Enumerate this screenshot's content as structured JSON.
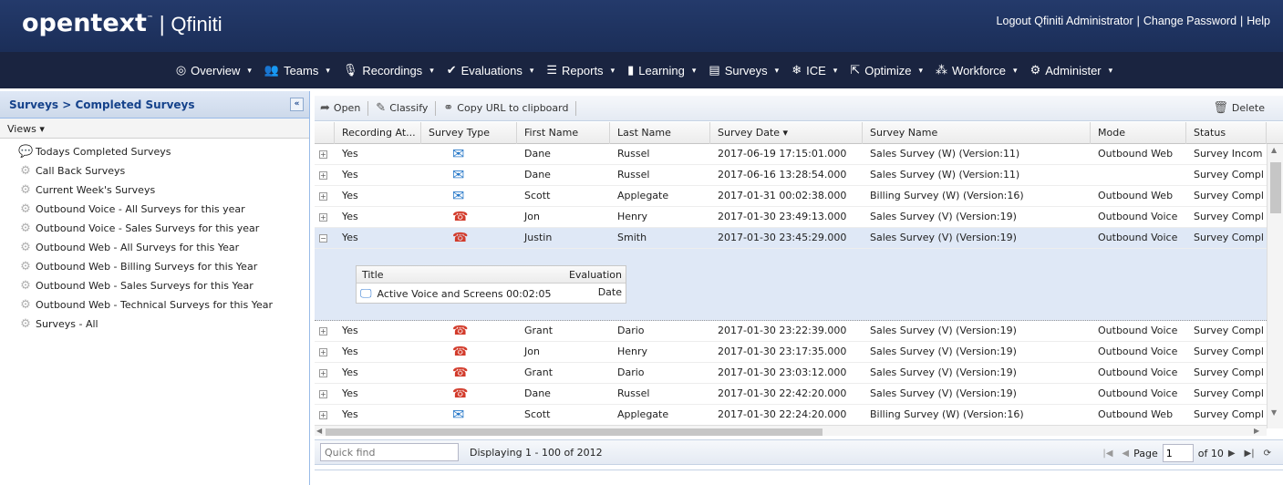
{
  "header": {
    "logo_brand": "opentext",
    "logo_tm": "™",
    "logo_sep": "|",
    "product": "Qfiniti",
    "links": [
      "Logout Qfiniti Administrator",
      "Change Password",
      "Help"
    ]
  },
  "nav": [
    {
      "label": "Overview",
      "icon": "globe-icon",
      "glyph": "◎"
    },
    {
      "label": "Teams",
      "icon": "people-icon",
      "glyph": "👥"
    },
    {
      "label": "Recordings",
      "icon": "microphone-icon",
      "glyph": "🎙"
    },
    {
      "label": "Evaluations",
      "icon": "checkmark-icon",
      "glyph": "✔"
    },
    {
      "label": "Reports",
      "icon": "report-icon",
      "glyph": "☰"
    },
    {
      "label": "Learning",
      "icon": "book-icon",
      "glyph": "▮"
    },
    {
      "label": "Surveys",
      "icon": "chat-icon",
      "glyph": "▤"
    },
    {
      "label": "ICE",
      "icon": "snowflake-icon",
      "glyph": "❄"
    },
    {
      "label": "Optimize",
      "icon": "export-icon",
      "glyph": "⇱"
    },
    {
      "label": "Workforce",
      "icon": "workforce-icon",
      "glyph": "⁂"
    },
    {
      "label": "Administer",
      "icon": "gear-icon",
      "glyph": "⚙"
    }
  ],
  "nav_caret": "▾",
  "left": {
    "title": "Surveys > Completed Surveys",
    "collapse": "«",
    "views_label": "Views ▾",
    "views": [
      "Todays Completed Surveys",
      "Call Back Surveys",
      "Current Week's Surveys",
      "Outbound Voice - All Surveys for this year",
      "Outbound Voice - Sales Surveys for this year",
      "Outbound Web - All Surveys for this Year",
      "Outbound Web - Billing Surveys for this Year",
      "Outbound Web - Sales Surveys for this Year",
      "Outbound Web - Technical Surveys for this Year",
      "Surveys - All"
    ]
  },
  "toolbar": {
    "open": "Open",
    "classify": "Classify",
    "copy_url": "Copy URL to clipboard",
    "delete": "Delete"
  },
  "grid": {
    "columns": [
      "Recording At...",
      "Survey Type",
      "First Name",
      "Last Name",
      "Survey Date ▾",
      "Survey Name",
      "Mode",
      "Status"
    ],
    "rows": [
      {
        "rec": "Yes",
        "type": "web",
        "first": "Dane",
        "last": "Russel",
        "date": "2017-06-19 17:15:01.000",
        "name": "Sales Survey (W) (Version:11)",
        "mode": "Outbound Web",
        "status": "Survey Incom"
      },
      {
        "rec": "Yes",
        "type": "web",
        "first": "Dane",
        "last": "Russel",
        "date": "2017-06-16 13:28:54.000",
        "name": "Sales Survey (W) (Version:11)",
        "mode": "",
        "status": "Survey Compl"
      },
      {
        "rec": "Yes",
        "type": "web",
        "first": "Scott",
        "last": "Applegate",
        "date": "2017-01-31 00:02:38.000",
        "name": "Billing Survey (W) (Version:16)",
        "mode": "Outbound Web",
        "status": "Survey Compl"
      },
      {
        "rec": "Yes",
        "type": "voice",
        "first": "Jon",
        "last": "Henry",
        "date": "2017-01-30 23:49:13.000",
        "name": "Sales Survey (V) (Version:19)",
        "mode": "Outbound Voice",
        "status": "Survey Compl"
      },
      {
        "rec": "Yes",
        "type": "voice",
        "first": "Justin",
        "last": "Smith",
        "date": "2017-01-30 23:45:29.000",
        "name": "Sales Survey (V) (Version:19)",
        "mode": "Outbound Voice",
        "status": "Survey Compl"
      },
      {
        "rec": "Yes",
        "type": "voice",
        "first": "Grant",
        "last": "Dario",
        "date": "2017-01-30 23:22:39.000",
        "name": "Sales Survey (V) (Version:19)",
        "mode": "Outbound Voice",
        "status": "Survey Compl"
      },
      {
        "rec": "Yes",
        "type": "voice",
        "first": "Jon",
        "last": "Henry",
        "date": "2017-01-30 23:17:35.000",
        "name": "Sales Survey (V) (Version:19)",
        "mode": "Outbound Voice",
        "status": "Survey Compl"
      },
      {
        "rec": "Yes",
        "type": "voice",
        "first": "Grant",
        "last": "Dario",
        "date": "2017-01-30 23:03:12.000",
        "name": "Sales Survey (V) (Version:19)",
        "mode": "Outbound Voice",
        "status": "Survey Compl"
      },
      {
        "rec": "Yes",
        "type": "voice",
        "first": "Dane",
        "last": "Russel",
        "date": "2017-01-30 22:42:20.000",
        "name": "Sales Survey (V) (Version:19)",
        "mode": "Outbound Voice",
        "status": "Survey Compl"
      },
      {
        "rec": "Yes",
        "type": "web",
        "first": "Scott",
        "last": "Applegate",
        "date": "2017-01-30 22:24:20.000",
        "name": "Billing Survey (W) (Version:16)",
        "mode": "Outbound Web",
        "status": "Survey Compl"
      }
    ],
    "expanded_row": 4,
    "detail": {
      "col_title": "Title",
      "col_eval": "Evaluation Date",
      "item": "Active Voice and Screens 00:02:05"
    }
  },
  "pager": {
    "quickfind_placeholder": "Quick find",
    "status": "Displaying 1 - 100 of 2012",
    "page_label": "Page",
    "page_value": "1",
    "of_label": "of 10"
  },
  "colors": {
    "header_bg": "#1b2e58",
    "nav_bg": "#1a2440",
    "selected_row": "#dfe8f6",
    "mail_icon": "#2a7ac9",
    "phone_icon": "#d23a2a"
  }
}
